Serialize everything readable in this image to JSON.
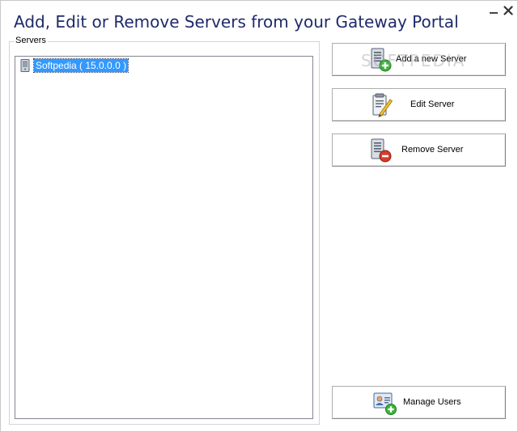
{
  "window": {
    "title": "Add, Edit or Remove Servers from your Gateway Portal"
  },
  "servers_group": {
    "label": "Servers",
    "items": [
      {
        "label": "Softpedia ( 15.0.0.0 )",
        "selected": true
      }
    ]
  },
  "buttons": {
    "add_server": "Add a new Server",
    "edit_server": "Edit Server",
    "remove_server": "Remove Server",
    "manage_users": "Manage Users"
  },
  "watermark": "SOFTPEDIA",
  "colors": {
    "title": "#1f2a6b",
    "selection": "#3399ff",
    "add_badge": "#3cb43c",
    "remove_badge": "#d93a2b"
  }
}
